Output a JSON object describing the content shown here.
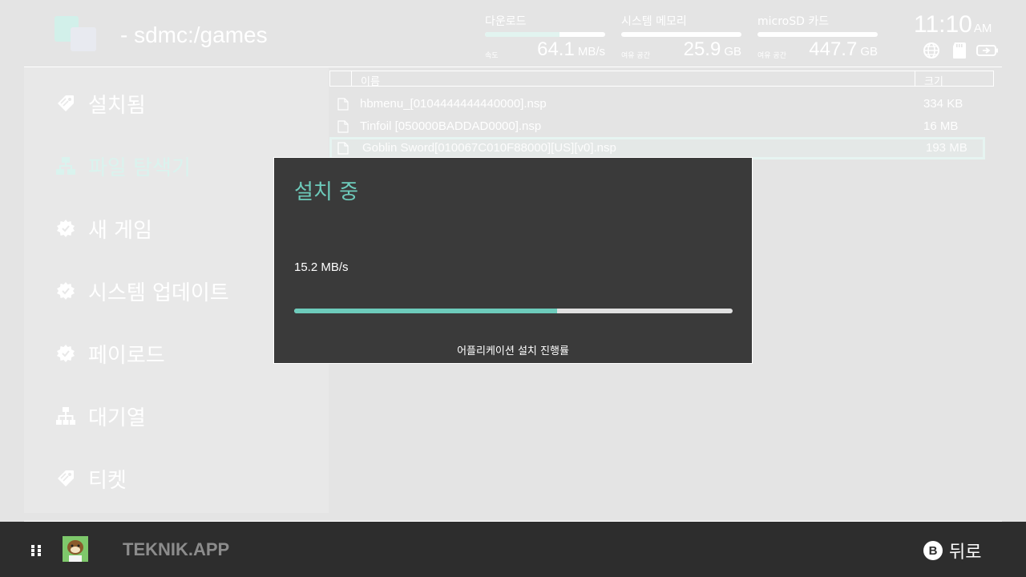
{
  "header": {
    "path": "- sdmc:/games",
    "download": {
      "label": "다운로드",
      "sublabel": "속도",
      "value": "64.1",
      "unit": "MB/s",
      "level": 0.62
    },
    "memory": {
      "label": "시스템 메모리",
      "sublabel": "여유 공간",
      "value": "25.9",
      "unit": "GB",
      "level": 0
    },
    "sd": {
      "label": "microSD 카드",
      "sublabel": "여유 공간",
      "value": "447.7",
      "unit": "GB",
      "level": 0
    },
    "time": "11:10",
    "ampm": "AM",
    "status_icons": [
      "globe-icon",
      "sd-card-icon",
      "battery-icon"
    ]
  },
  "sidebar": {
    "items": [
      {
        "label": "설치됨",
        "icon": "tag-icon"
      },
      {
        "label": "파일 탐색기",
        "icon": "folder-tree-icon",
        "active": true
      },
      {
        "label": "새 게임",
        "icon": "badge-icon"
      },
      {
        "label": "시스템 업데이트",
        "icon": "badge-icon"
      },
      {
        "label": "페이로드",
        "icon": "badge-icon"
      },
      {
        "label": "대기열",
        "icon": "sitemap-icon"
      },
      {
        "label": "티켓",
        "icon": "tag-icon"
      }
    ]
  },
  "table": {
    "col_name": "이름",
    "col_size": "크기",
    "rows": [
      {
        "name": "hbmenu_[0104444444440000].nsp",
        "size": "334 KB"
      },
      {
        "name": "Tinfoil [050000BADDAD0000].nsp",
        "size": "16 MB"
      },
      {
        "name": "Goblin Sword[010067C010F88000][US][v0].nsp",
        "size": "193 MB",
        "selected": true
      }
    ]
  },
  "dialog": {
    "title": "설치 중",
    "speed": "15.2 MB/s",
    "progress": 0.6,
    "caption": "어플리케이션 설치 진행률"
  },
  "footer": {
    "username": "TEKNIK.APP",
    "back_button": "B",
    "back_label": "뒤로"
  },
  "colors": {
    "accent": "#6dcbbb",
    "background": "#e4e4e4",
    "dialog": "#3a3a3a",
    "footer": "#2d2d2d"
  }
}
